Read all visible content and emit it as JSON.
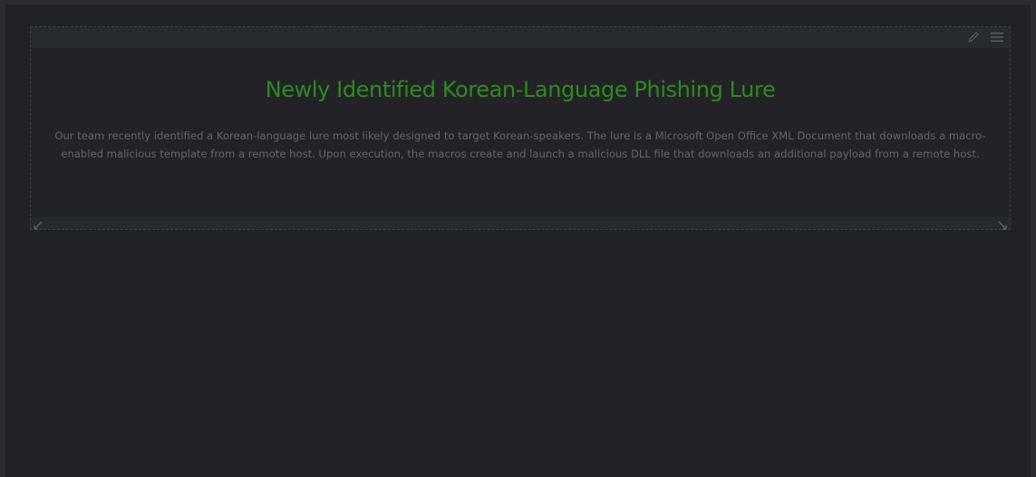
{
  "panel": {
    "title": "Newly Identified Korean-Language Phishing Lure",
    "description": "Our team recently identified a Korean-language lure most likely designed to target Korean-speakers. The lure is a Microsoft Open Office XML Document that downloads a macro-enabled malicious template from a remote host. Upon execution, the macros create and launch a malicious DLL file that downloads an additional payload from a remote host.",
    "icons": {
      "edit": "pencil-icon",
      "menu": "hamburger-menu-icon",
      "resize_left": "resize-arrow-icon",
      "resize_right": "resize-arrow-icon"
    }
  },
  "colors": {
    "title": "#2d8a1f",
    "text": "#62656a",
    "background": "#222226",
    "panel_border": "#3b4046"
  }
}
